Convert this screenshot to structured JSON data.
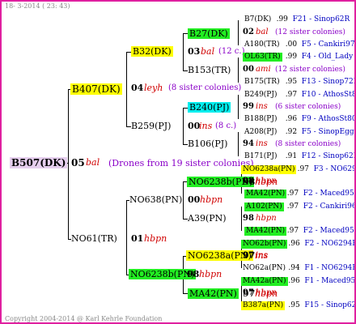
{
  "header": {
    "date": "18- 3-2014 ( 23: 43)"
  },
  "footer": {
    "copyright": "Copyright 2004-2014 @ Karl Kehrle Foundation"
  },
  "colors": {
    "border": "#e020a0",
    "yellow": "#ffff00",
    "green": "#22ee22",
    "cyan": "#00eeee",
    "lavender": "#e6cfee",
    "red": "#d00000",
    "purple": "#8a00c8",
    "blue": "#0000c0"
  },
  "root": {
    "name": "B507(DK)",
    "gen": "05",
    "breeder": "bal",
    "note": "(Drones from 19 sister colonies)"
  },
  "g1": {
    "top": {
      "name": "B407(DK)",
      "gen": "04",
      "breeder": "leyh",
      "note": "(8 sister colonies)"
    },
    "bot": {
      "name": "NO61(TR)",
      "gen": "01",
      "breeder": "hbpn"
    }
  },
  "g2": {
    "a": {
      "name": "B32(DK)",
      "gen": "03",
      "breeder": "bal",
      "note": "(12 c.)"
    },
    "b": {
      "name": "B259(PJ)",
      "gen": "00",
      "breeder": "ins",
      "note": "(8 c.)"
    },
    "c": {
      "name": "NO638(PN)",
      "gen": "00",
      "breeder": "hbpn"
    },
    "d": {
      "name": "NO6238b(PN)",
      "gen": "98",
      "breeder": "hbpn"
    }
  },
  "g3": {
    "a1": {
      "name": "B27(DK)"
    },
    "a2": {
      "name": "B153(TR)"
    },
    "b1": {
      "name": "B240(PJ)"
    },
    "b2": {
      "name": "B106(PJ)"
    },
    "c1": {
      "name": "NO6238b(PN)",
      "gen": "98",
      "breeder": "hbpn"
    },
    "c2": {
      "name": "A39(PN)"
    },
    "d1": {
      "name": "NO6238a(PN)",
      "gen": "97",
      "breeder": "ins"
    },
    "d2": {
      "name": "MA42(PN)",
      "gen": "97",
      "breeder": "hbpn"
    }
  },
  "g4": [
    {
      "name": "B7(DK)",
      "val": ".99",
      "loc": "F21 - Sinop62R"
    },
    {
      "gen": "02",
      "breeder": "bal",
      "note": "(12 sister colonies)"
    },
    {
      "name": "A180(TR)",
      "val": ".00",
      "loc": "F5 - Cankiri97Q"
    },
    {
      "name": "OL63(TR)",
      "val": ".99",
      "loc": "F4 - Old_Lady"
    },
    {
      "gen": "00",
      "breeder": "ami",
      "note": "(12 sister colonies)"
    },
    {
      "name": "B175(TR)",
      "val": ".95",
      "loc": "F13 - Sinop72R"
    },
    {
      "name": "B249(PJ)",
      "val": ".97",
      "loc": "F10 - AthosSt80R"
    },
    {
      "gen": "99",
      "breeder": "ins",
      "note": "(6 sister colonies)"
    },
    {
      "name": "B188(PJ)",
      "val": ".96",
      "loc": "F9 - AthosSt80R"
    },
    {
      "name": "A208(PJ)",
      "val": ".92",
      "loc": "F5 - SinopEgg86R"
    },
    {
      "gen": "94",
      "breeder": "ins",
      "note": "(8 sister colonies)"
    },
    {
      "name": "B171(PJ)",
      "val": ".91",
      "loc": "F12 - Sinop62R"
    },
    {
      "name": "NO6238a(PN)",
      "val": ".97",
      "loc": "F3 - NO6294R"
    },
    {
      "gen": "98",
      "breeder": "hbpn"
    },
    {
      "name": "MA42(PN)",
      "val": ".97",
      "loc": "F2 - Maced95R"
    },
    {
      "name": "A102(PN)",
      "val": ".97",
      "loc": "F2 - Cankiri96R"
    },
    {
      "gen": "98",
      "breeder": "hbpn"
    },
    {
      "name": "MA42(PN)",
      "val": ".97",
      "loc": "F2 - Maced95R"
    },
    {
      "name": "NO62b(PN)",
      "val": ".96",
      "loc": "F2 - NO6294R"
    },
    {
      "gen": "97",
      "breeder": "ins"
    },
    {
      "name": "NO62a(PN)",
      "val": ".94",
      "loc": "F1 - NO6294R"
    },
    {
      "name": "MA42a(PN)",
      "val": ".96",
      "loc": "F1 - Maced95R"
    },
    {
      "gen": "97",
      "breeder": "hbpn"
    },
    {
      "name": "B387a(PN)",
      "val": ".95",
      "loc": "F15 - Sinop62R"
    }
  ]
}
